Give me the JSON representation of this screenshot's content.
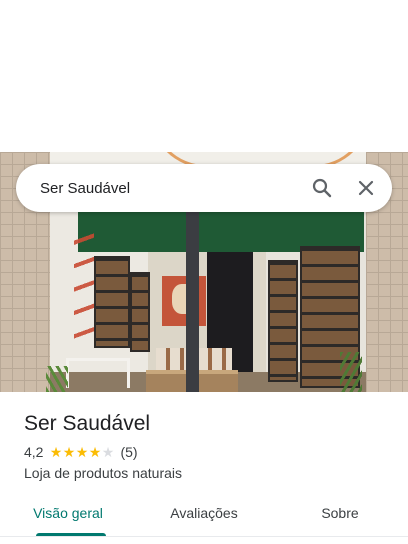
{
  "search": {
    "query": "Ser Saudável",
    "search_icon": "search-icon",
    "close_icon": "close-icon"
  },
  "photo": {
    "description_icon": "store-photo"
  },
  "place": {
    "name": "Ser Saudável",
    "rating": "4,2",
    "rating_value": 4.2,
    "stars_full": 4,
    "stars_total": 5,
    "review_count": "(5)",
    "category": "Loja de produtos naturais"
  },
  "tabs": [
    {
      "label": "Visão geral",
      "active": true
    },
    {
      "label": "Avaliações",
      "active": false
    },
    {
      "label": "Sobre",
      "active": false
    }
  ],
  "colors": {
    "accent": "#01796f",
    "star": "#fbbc04",
    "star_empty": "#dadce0"
  }
}
